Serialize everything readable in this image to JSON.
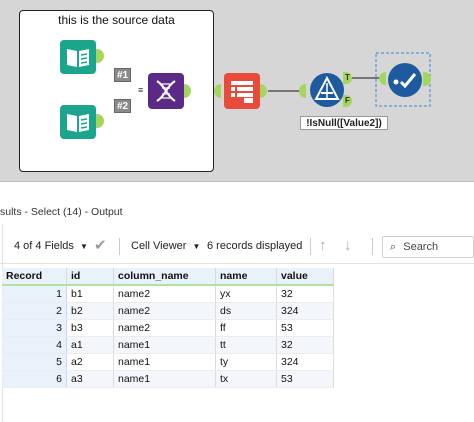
{
  "canvas": {
    "container_title": "this is the source data",
    "union_labels": [
      "#1",
      "#2"
    ],
    "filter_anchor_true": "T",
    "filter_anchor_false": "F",
    "filter_expression": "!IsNull([Value2])",
    "connection_label": "≡",
    "colors": {
      "canvas_bg": "#d6d6d6",
      "input_teal": "#1aa58c",
      "transpose_purple": "#5b2a86",
      "select_red": "#e84b3a",
      "filter_blue": "#1d5b9e",
      "browse_blue": "#1d5b9e",
      "anchor_green": "#a4d65e"
    }
  },
  "results": {
    "title": "sults - Select (14) - Output",
    "fields_label": "4 of 4 Fields",
    "viewer_label": "Cell Viewer",
    "records_label": "6 records displayed",
    "search_placeholder": "Search"
  },
  "table": {
    "headers": [
      "Record",
      "id",
      "column_name",
      "name",
      "value"
    ],
    "rows": [
      [
        "1",
        "b1",
        "name2",
        "yx",
        "32"
      ],
      [
        "2",
        "b2",
        "name2",
        "ds",
        "324"
      ],
      [
        "3",
        "b3",
        "name2",
        "ff",
        "53"
      ],
      [
        "4",
        "a1",
        "name1",
        "tt",
        "32"
      ],
      [
        "5",
        "a2",
        "name1",
        "ty",
        "324"
      ],
      [
        "6",
        "a3",
        "name1",
        "tx",
        "53"
      ]
    ]
  }
}
